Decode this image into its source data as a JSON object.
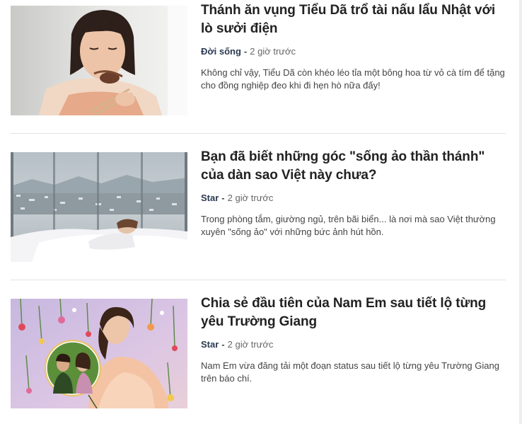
{
  "articles": [
    {
      "title": "Thánh ăn vụng Tiểu Dã trổ tài nấu lẩu Nhật với lò sưởi điện",
      "category": "Đời sống",
      "separator": "-",
      "time": "2 giờ trước",
      "summary": "Không chỉ vậy, Tiểu Dã còn khéo léo tỉa một bông hoa từ vỏ cà tím để tặng cho đồng nghiệp đeo khi đi hẹn hò nữa đấy!"
    },
    {
      "title": "Bạn đã biết những góc \"sống ảo thần thánh\" của dàn sao Việt này chưa?",
      "category": "Star",
      "separator": "-",
      "time": "2 giờ trước",
      "summary": "Trong phòng tắm, giường ngủ, trên bãi biển... là nơi mà sao Việt thường xuyên \"sống ảo\" với những bức ảnh hút hồn."
    },
    {
      "title": "Chia sẻ đầu tiên của Nam Em sau tiết lộ từng yêu Trường Giang",
      "category": "Star",
      "separator": "-",
      "time": "2 giờ trước",
      "summary": "Nam Em vừa đăng tải một đoạn status sau tiết lộ từng yêu Trường Giang trên báo chí."
    }
  ]
}
